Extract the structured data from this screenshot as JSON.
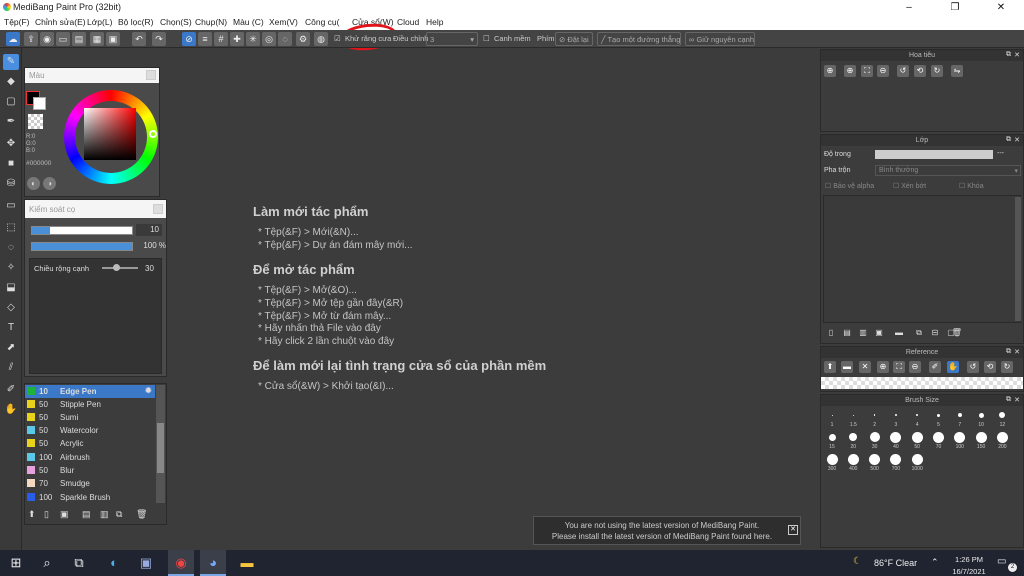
{
  "window": {
    "title": "MediBang Paint Pro (32bit)"
  },
  "menu": [
    "Tệp(F)",
    "Chỉnh sửa(E)",
    "Lớp(L)",
    "Bộ lọc(R)",
    "Chọn(S)",
    "Chụp(N)",
    "Màu (C)",
    "Xem(V)",
    "Công cụ(",
    "Cửa sổ(W)",
    "Cloud",
    "Help"
  ],
  "toolbar": {
    "antialias_label": "Khử răng cưa",
    "correction_label": "Điều chỉnh",
    "correction_value": "3",
    "smooth_label": "Canh mềm",
    "shortcut_label": "Phím",
    "off_label": "Đặt lại",
    "create_line_label": "Tạo một đường thẳng",
    "keep_original_label": "Giữ nguyên cạnh"
  },
  "color_panel": {
    "title": "Màu",
    "r": "R:0",
    "g": "G:0",
    "b": "B:0",
    "hex": "#000000"
  },
  "brush_control": {
    "title": "Kiểm soát cọ",
    "size": "10",
    "opacity": "100 %",
    "edge_label": "Chiều rộng cạnh",
    "edge_value": "30"
  },
  "brushes": [
    {
      "size": "10",
      "name": "Edge Pen",
      "color": "#1db33b",
      "selected": true
    },
    {
      "size": "50",
      "name": "Stipple Pen",
      "color": "#e8d21a"
    },
    {
      "size": "50",
      "name": "Sumi",
      "color": "#e8d21a"
    },
    {
      "size": "50",
      "name": "Watercolor",
      "color": "#5bc8e8"
    },
    {
      "size": "50",
      "name": "Acrylic",
      "color": "#e8d21a"
    },
    {
      "size": "100",
      "name": "Airbrush",
      "color": "#5bc8e8"
    },
    {
      "size": "50",
      "name": "Blur",
      "color": "#e8a0e0"
    },
    {
      "size": "70",
      "name": "Smudge",
      "color": "#f5d8c0"
    },
    {
      "size": "100",
      "name": "Sparkle Brush",
      "color": "#2a5ce8"
    }
  ],
  "content": {
    "heading1": "Làm mới tác phẩm",
    "items1": [
      "* Tệp(&F) > Mới(&N)...",
      "* Tệp(&F) > Dự án đám mây mới..."
    ],
    "heading2": "Để mở tác phẩm",
    "items2": [
      "* Tệp(&F) > Mở(&O)...",
      "* Tệp(&F) > Mở tệp gần đây(&R)",
      "* Tệp(&F) > Mở từ đám mây...",
      "* Hãy nhấn thả File vào đây",
      "* Hãy click 2 lần chuột vào đây"
    ],
    "heading3": "Để làm mới lại tình trạng cửa sổ của phần mềm",
    "items3": [
      "* Cửa sổ(&W) > Khởi tạo(&I)..."
    ]
  },
  "navigator": {
    "title": "Hoa tiêu"
  },
  "layer": {
    "title": "Lớp",
    "opacity_label": "Độ trong",
    "opacity_value": "---",
    "blend_label": "Pha trộn",
    "blend_value": "Bình thường",
    "protect_alpha": "Bảo vệ alpha",
    "clipping": "Xén bớt",
    "lock": "Khóa"
  },
  "reference": {
    "title": "Reference"
  },
  "brush_size": {
    "title": "Brush Size",
    "sizes": [
      "1",
      "1.5",
      "2",
      "3",
      "4",
      "5",
      "7",
      "10",
      "12",
      "15",
      "20",
      "30",
      "40",
      "50",
      "70",
      "100",
      "150",
      "200",
      "300",
      "400",
      "500",
      "700",
      "1000"
    ]
  },
  "notification": {
    "line1": "You are not using the latest version of MediBang Paint.",
    "line2": "Please install the latest version of MediBang Paint found here."
  },
  "taskbar": {
    "weather": "86°F  Clear",
    "time": "1:26 PM",
    "date": "16/7/2021",
    "notif_count": "2"
  }
}
